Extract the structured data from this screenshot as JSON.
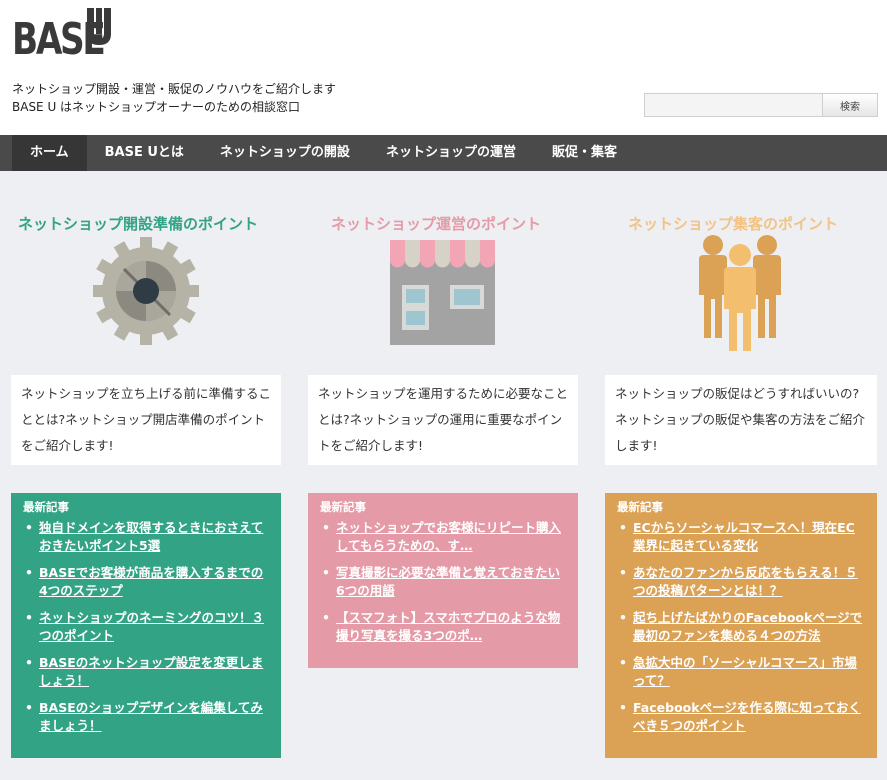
{
  "header": {
    "logo_text": "BASE",
    "logo_u": "U",
    "tagline_1": "ネットショップ開設・運営・販促のノウハウをご紹介します",
    "tagline_2": "BASE U はネットショップオーナーのための相談窓口",
    "search_placeholder": "",
    "search_button": "検索"
  },
  "nav": {
    "items": [
      {
        "label": "ホーム"
      },
      {
        "label": "BASE Uとは"
      },
      {
        "label": "ネットショップの開設"
      },
      {
        "label": "ネットショップの運営"
      },
      {
        "label": "販促・集客"
      }
    ]
  },
  "columns": [
    {
      "title": "ネットショップ開設準備のポイント",
      "icon": "gear-icon",
      "description": "ネットショップを立ち上げる前に準備することとは?ネットショップ開店準備のポイントをご紹介します!",
      "news_heading": "最新記事",
      "color": "#33a386",
      "articles": [
        "独自ドメインを取得するときにおさえておきたいポイント5選",
        "BASEでお客様が商品を購入するまでの4つのステップ",
        "ネットショップのネーミングのコツ！３つのポイント",
        "BASEのネットショップ設定を変更しましょう！",
        "BASEのショップデザインを編集してみましょう！"
      ]
    },
    {
      "title": "ネットショップ運営のポイント",
      "icon": "shop-icon",
      "description": "ネットショップを運用するために必要なこととは?ネットショップの運用に重要なポイントをご紹介します!",
      "news_heading": "最新記事",
      "color": "#e59aa7",
      "articles": [
        "ネットショップでお客様にリピート購入してもらうための、す…",
        "写真撮影に必要な準備と覚えておきたい6つの用語",
        "【スマフォト】スマホでプロのような物撮り写真を撮る3つのポ…"
      ]
    },
    {
      "title": "ネットショップ集客のポイント",
      "icon": "people-icon",
      "description": "ネットショップの販促はどうすればいいの?ネットショップの販促や集客の方法をご紹介します!",
      "news_heading": "最新記事",
      "color": "#dba154",
      "articles": [
        "ECからソーシャルコマースへ！現在EC業界に起きている変化",
        "あなたのファンから反応をもらえる！５つの投稿パターンとは！？",
        "起ち上げたばかりのFacebookページで最初のファンを集める４つの方法",
        "急拡大中の「ソーシャルコマース」市場って？",
        "Facebookページを作る際に知っておくべき５つのポイント"
      ]
    }
  ]
}
